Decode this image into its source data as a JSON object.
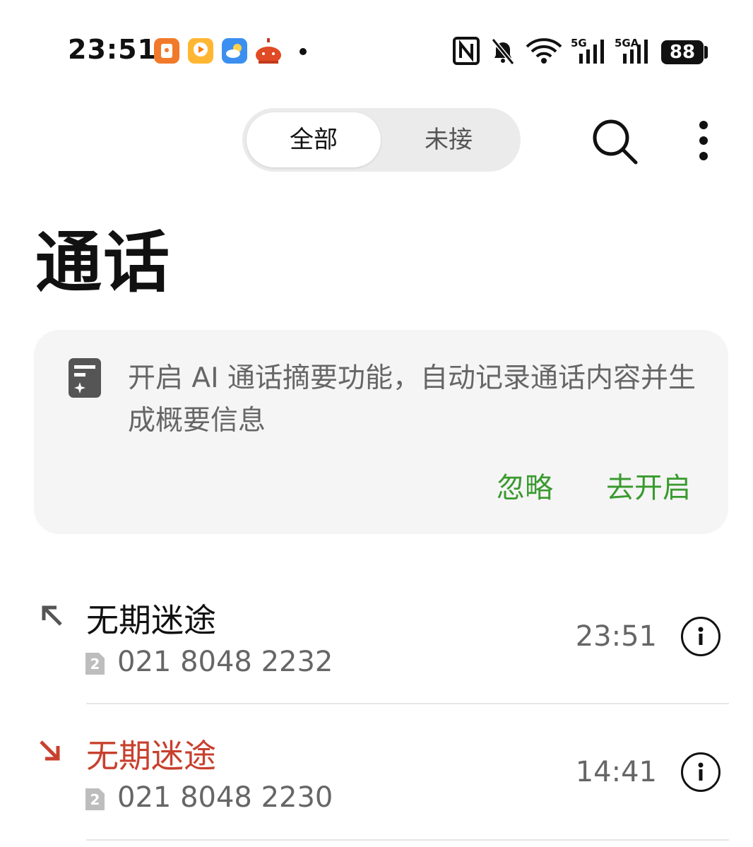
{
  "status_bar": {
    "time": "23:51",
    "app_icons": [
      "red-envelope-app-icon",
      "video-app-icon",
      "weather-app-icon",
      "lantern-app-icon"
    ],
    "network_5g": "5G",
    "network_5ga": "5GA",
    "battery": "88"
  },
  "tabs": {
    "all": "全部",
    "missed": "未接"
  },
  "page_title": "通话",
  "ai_banner": {
    "text": "开启 AI 通话摘要功能，自动记录通话内容并生成概要信息",
    "ignore_label": "忽略",
    "enable_label": "去开启"
  },
  "calls": [
    {
      "name": "无期迷途",
      "sim": "2",
      "number": "021 8048 2232",
      "time": "23:51",
      "type": "outgoing"
    },
    {
      "name": "无期迷途",
      "sim": "2",
      "number": "021 8048 2230",
      "time": "14:41",
      "type": "missed"
    }
  ],
  "colors": {
    "accent_green": "#3a9a2f",
    "missed_red": "#c8402e"
  }
}
